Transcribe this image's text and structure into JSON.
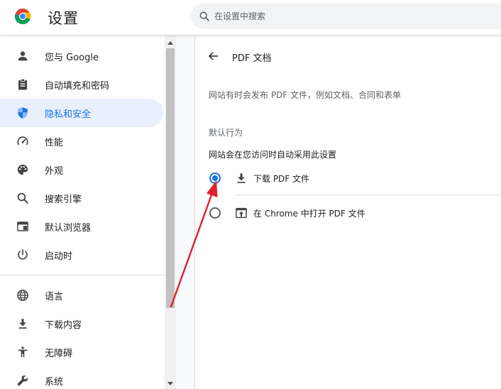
{
  "header": {
    "title": "设置",
    "search_placeholder": "在设置中搜索",
    "search_value": ""
  },
  "sidebar": {
    "items": [
      {
        "label": "您与 Google",
        "icon": "person-icon",
        "active": false
      },
      {
        "label": "自动填充和密码",
        "icon": "clipboard-icon",
        "active": false
      },
      {
        "label": "隐私和安全",
        "icon": "shield-icon",
        "active": true
      },
      {
        "label": "性能",
        "icon": "speedometer-icon",
        "active": false
      },
      {
        "label": "外观",
        "icon": "palette-icon",
        "active": false
      },
      {
        "label": "搜索引擎",
        "icon": "search-icon",
        "active": false
      },
      {
        "label": "默认浏览器",
        "icon": "browser-window-icon",
        "active": false
      },
      {
        "label": "启动时",
        "icon": "power-icon",
        "active": false
      },
      {
        "label": "语言",
        "icon": "globe-icon",
        "active": false
      },
      {
        "label": "下载内容",
        "icon": "download-icon",
        "active": false
      },
      {
        "label": "无障碍",
        "icon": "accessibility-icon",
        "active": false
      },
      {
        "label": "系统",
        "icon": "wrench-icon",
        "active": false
      }
    ]
  },
  "content": {
    "page_title": "PDF 文档",
    "description": "网站有时会发布 PDF 文件，例如文档、合同和表单",
    "section_title": "默认行为",
    "section_subtitle": "网站会在您访问时自动采用此设置",
    "options": [
      {
        "label": "下载 PDF 文件",
        "icon": "download-icon",
        "selected": true
      },
      {
        "label": "在 Chrome 中打开 PDF 文件",
        "icon": "open-in-browser-icon",
        "selected": false
      }
    ]
  },
  "colors": {
    "accent": "#1a73e8",
    "active_bg": "#e8f0fe",
    "annotation_arrow": "#e0202a"
  }
}
